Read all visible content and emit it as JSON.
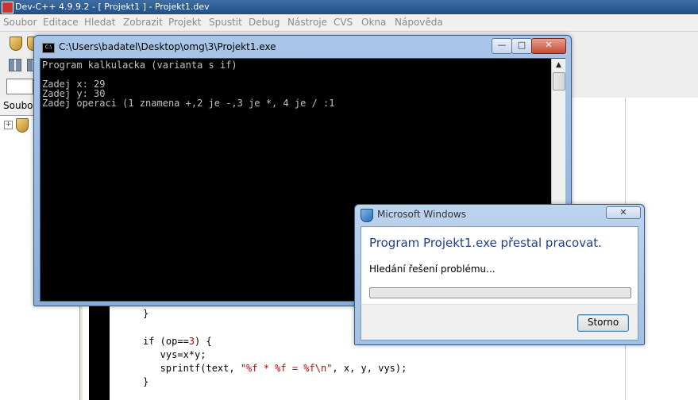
{
  "main_window": {
    "title": "Dev-C++ 4.9.9.2 - [ Projekt1 ] - Projekt1.dev",
    "menu": [
      "Soubor",
      "Editace",
      "Hledat",
      "Zobrazit",
      "Projekt",
      "Spustit",
      "Debug",
      "Nástroje",
      "CVS",
      "Okna",
      "Nápověda"
    ],
    "left_tab": "Soubory",
    "code_lines": [
      {
        "plain": "}"
      },
      {
        "pre": "if (op==",
        "num": "3",
        "post": ") {"
      },
      {
        "plain": "   vys=x*y;"
      },
      {
        "pre": "   sprintf(text, ",
        "str": "\"%f * %f = %f\\n\"",
        "post": ", x, y, vys);"
      },
      {
        "plain": "}"
      }
    ]
  },
  "console": {
    "title": "C:\\Users\\badatel\\Desktop\\omg\\3\\Projekt1.exe",
    "lines": [
      "Program kalkulacka (varianta s if)",
      "",
      "Zadej x: 29",
      "Zadej y: 30",
      "Zadej operaci (1 znamena +,2 je -,3 je *, 4 je / :1"
    ]
  },
  "dialog": {
    "title": "Microsoft Windows",
    "heading": "Program Projekt1.exe přestal pracovat.",
    "status": "Hledání řešení problému...",
    "cancel_label": "Storno",
    "progress_fraction": 0.0
  }
}
